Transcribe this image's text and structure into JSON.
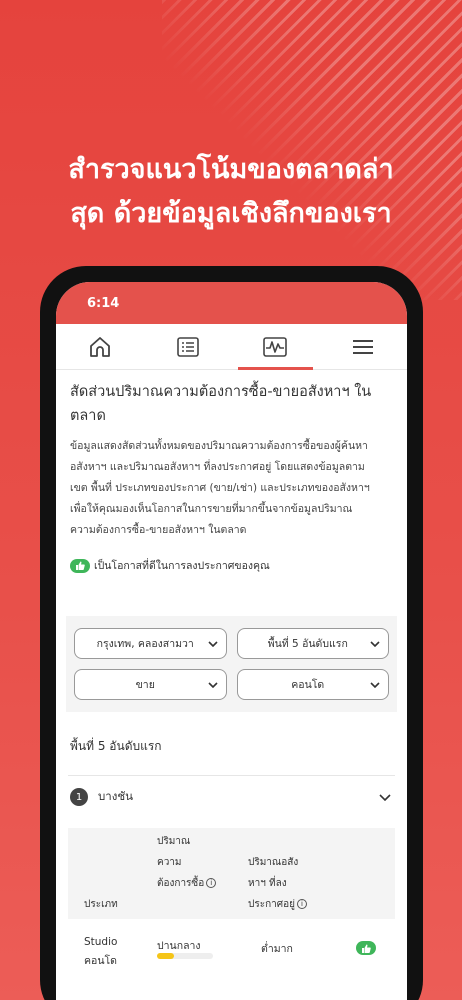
{
  "headline": {
    "line1": "สำรวจแนวโน้มของตลาดล่า",
    "line2": "สุด ด้วยข้อมูลเชิงลึกของเรา"
  },
  "status_bar": {
    "time": "6:14"
  },
  "nav_tabs": [
    "home-icon",
    "list-icon",
    "chart-icon",
    "menu-icon"
  ],
  "active_tab": 2,
  "page": {
    "title_line1": "สัดส่วนปริมาณความต้องการซื้อ-ขายอสังหาฯ ใน",
    "title_line2": "ตลาด",
    "desc": [
      "ข้อมูลแสดงสัดส่วนทั้งหมดของปริมาณความต้องการซื้อของผู้ค้นหา",
      "อสังหาฯ และปริมาณอสังหาฯ ที่ลงประกาศอยู่ โดยแสดงข้อมูลตาม",
      "เขต พื้นที่ ประเภทของประกาศ (ขาย/เช่า) และประเภทของอสังหาฯ",
      "เพื่อให้คุณมองเห็นโอกาสในการขายที่มากขึ้นจากข้อมูลปริมาณ",
      "ความต้องการซื้อ-ขายอสังหาฯ ในตลาด"
    ],
    "opportunity_label": "เป็นโอกาสที่ดีในการลงประกาศของคุณ"
  },
  "filters": {
    "location": "กรุงเทพ, คลองสามวา",
    "ranking": "พื้นที่ 5 อันดับแรก",
    "listing_type": "ขาย",
    "property_type": "คอนโด"
  },
  "results": {
    "section_title": "พื้นที่ 5 อันดับแรก",
    "district_rank": "1",
    "district_name": "บางชัน",
    "columns": {
      "type": "ประเภท",
      "demand": [
        "ปริมาณ",
        "ความ",
        "ต้องการซื้อ"
      ],
      "supply": [
        "ปริมาณอสัง",
        "หาฯ ที่ลง",
        "ประกาศอยู่"
      ]
    },
    "rows": [
      {
        "type_line1": "Studio",
        "type_line2": "คอนโด",
        "demand": "ปานกลาง",
        "demand_level": 0.3,
        "supply": "ต่ำมาก"
      }
    ]
  },
  "colors": {
    "accent": "#e4524c",
    "good": "#3fb65a",
    "bar": "#f5c518"
  }
}
